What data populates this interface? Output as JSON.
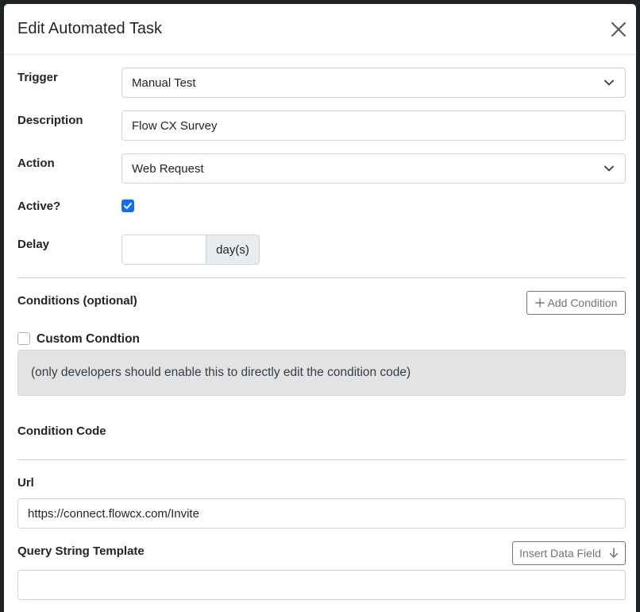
{
  "modal": {
    "title": "Edit Automated Task"
  },
  "form": {
    "trigger": {
      "label": "Trigger",
      "value": "Manual Test"
    },
    "description": {
      "label": "Description",
      "value": "Flow CX Survey"
    },
    "action": {
      "label": "Action",
      "value": "Web Request"
    },
    "active": {
      "label": "Active?",
      "checked": true
    },
    "delay": {
      "label": "Delay",
      "value": "",
      "unit": "day(s)"
    },
    "conditions": {
      "label": "Conditions (optional)",
      "add_button": "Add Condition"
    },
    "custom_condition": {
      "label": "Custom Condtion",
      "checked": false,
      "info": "(only developers should enable this to directly edit the condition code)"
    },
    "condition_code": {
      "label": "Condition Code"
    },
    "url": {
      "label": "Url",
      "value": "https://connect.flowcx.com/Invite"
    },
    "query_string": {
      "label": "Query String Template",
      "insert_button": "Insert Data Field",
      "value": ""
    }
  },
  "colors": {
    "primary": "#0d6efd",
    "secondary": "#6c757d",
    "info_bg": "#e2e3e5"
  }
}
